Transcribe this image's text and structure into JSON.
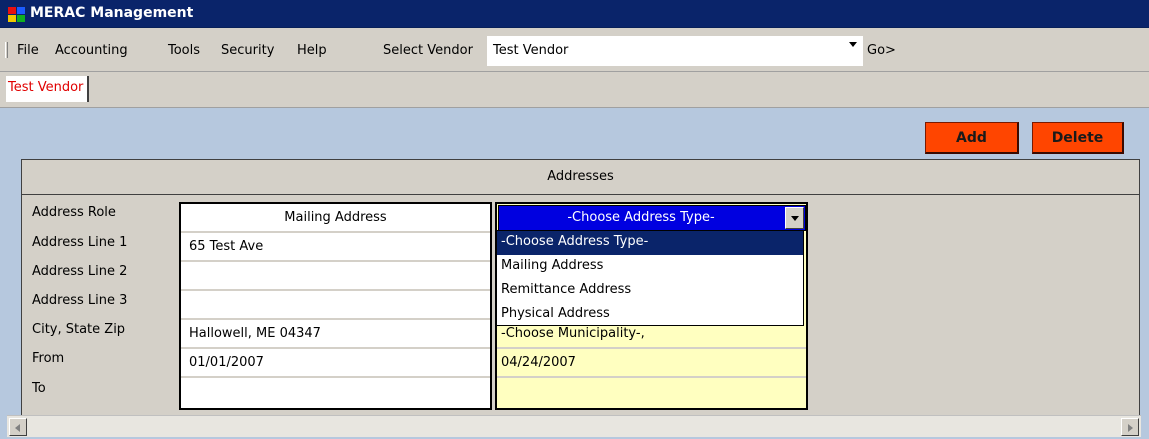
{
  "window": {
    "title": "MERAC Management"
  },
  "menu": {
    "items": [
      "File",
      "Accounting",
      "Tools",
      "Security",
      "Help"
    ],
    "select_vendor_label": "Select Vendor",
    "select_vendor_value": "Test Vendor",
    "go_label": "Go>"
  },
  "tabs": [
    {
      "label": "Test Vendor",
      "color": "#e00000"
    }
  ],
  "actions": {
    "add_label": "Add",
    "delete_label": "Delete",
    "accent": "#ff4500"
  },
  "addresses": {
    "header": "Addresses",
    "row_labels": [
      "Address Role",
      "Address Line 1",
      "Address Line 2",
      "Address Line 3",
      "City, State  Zip",
      "From",
      "To"
    ],
    "record1": {
      "role": "Mailing Address",
      "line1": "65 Test Ave",
      "line2": "",
      "line3": "",
      "city_state_zip": "Hallowell, ME  04347",
      "from": "01/01/2007",
      "to": ""
    },
    "record2": {
      "role_select_value": "-Choose Address Type-",
      "municipality": "-Choose Municipality-,",
      "from": "04/24/2007",
      "to": ""
    },
    "dropdown_options": [
      "-Choose Address Type-",
      "Mailing Address",
      "Remittance Address",
      "Physical Address"
    ],
    "dropdown_selected_index": 0
  },
  "colors": {
    "titlebar": "#0a246a",
    "panel": "#b6c8de",
    "editable_cell": "#ffffc0",
    "select_highlight": "#0000e0"
  }
}
